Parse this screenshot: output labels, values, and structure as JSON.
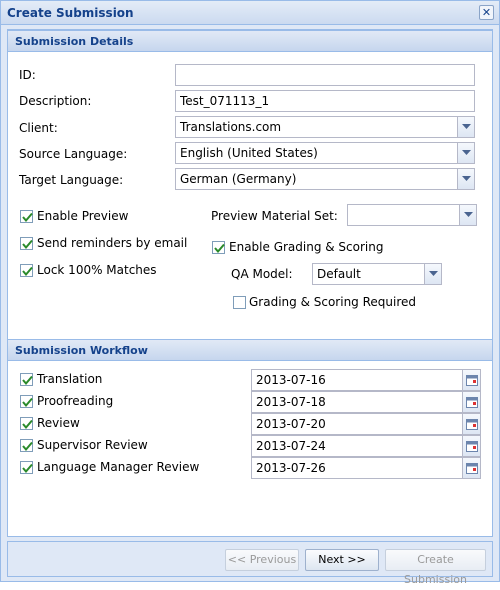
{
  "window": {
    "title": "Create Submission"
  },
  "details": {
    "header": "Submission Details",
    "id_label": "ID:",
    "id_value": "",
    "description_label": "Description:",
    "description_value": "Test_071113_1",
    "client_label": "Client:",
    "client_value": "Translations.com",
    "source_label": "Source Language:",
    "source_value": "English (United States)",
    "target_label": "Target Language:",
    "target_value": "German (Germany)",
    "enable_preview": {
      "label": "Enable Preview",
      "checked": true
    },
    "send_reminders": {
      "label": "Send reminders by email",
      "checked": true
    },
    "lock_matches": {
      "label": "Lock 100% Matches",
      "checked": true
    },
    "preview_material_label": "Preview Material Set:",
    "preview_material_value": "",
    "enable_grading": {
      "label": "Enable Grading & Scoring",
      "checked": true
    },
    "qa_model_label": "QA Model:",
    "qa_model_value": "Default",
    "grading_required": {
      "label": "Grading & Scoring Required",
      "checked": false
    }
  },
  "workflow": {
    "header": "Submission Workflow",
    "steps": [
      {
        "label": "Translation",
        "checked": true,
        "date": "2013-07-16"
      },
      {
        "label": "Proofreading",
        "checked": true,
        "date": "2013-07-18"
      },
      {
        "label": "Review",
        "checked": true,
        "date": "2013-07-20"
      },
      {
        "label": "Supervisor Review",
        "checked": true,
        "date": "2013-07-24"
      },
      {
        "label": "Language Manager Review",
        "checked": true,
        "date": "2013-07-26"
      }
    ]
  },
  "footer": {
    "previous_label": "<< Previous",
    "next_label": "Next >>",
    "create_label": "Create Submission"
  },
  "colors": {
    "accent": "#15428b",
    "border": "#99bbe8",
    "panel": "#dfe8f6",
    "check": "#2a8a2a"
  }
}
